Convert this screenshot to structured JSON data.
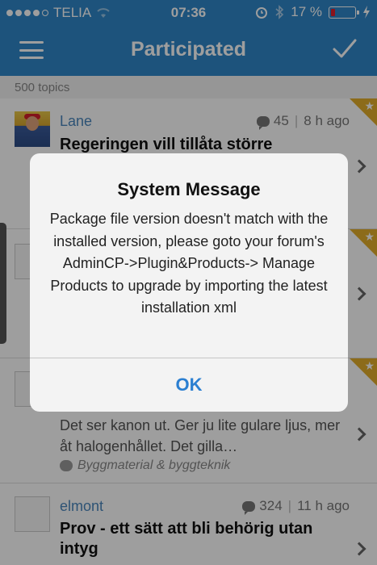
{
  "status_bar": {
    "carrier": "TELIA",
    "time": "07:36",
    "battery_percent": "17 %",
    "battery_level": 0.17
  },
  "nav": {
    "title": "Participated",
    "menu_icon": "hamburger-menu-icon",
    "confirm_icon": "checkmark-icon"
  },
  "topic_count": "500 topics",
  "topics": [
    {
      "author": "Lane",
      "replies": "45",
      "time": "8 h ago",
      "title": "Regeringen vill tillåta större",
      "avatar": "photo"
    },
    {
      "author": "",
      "replies": "",
      "time": "",
      "title": "",
      "avatar": "placeholder"
    },
    {
      "author": "",
      "replies": "",
      "time": "",
      "preview": "Det ser kanon ut. Ger ju lite gularе ljus, mer åt halogenhållet. Det gilla…",
      "category": "Byggmaterial & byggteknik",
      "avatar": "placeholder"
    },
    {
      "author": "elmont",
      "replies": "324",
      "time": "11 h ago",
      "title": "Prov - ett sätt att bli behörig utan intyg",
      "avatar": "placeholder"
    }
  ],
  "alert": {
    "title": "System Message",
    "message": "Package file version doesn't match with the installed version, please goto your forum's AdminCP->Plugin&Products-> Manage Products to upgrade by importing the latest installation xml",
    "button": "OK"
  },
  "colors": {
    "nav_bg": "#2f86c9",
    "link": "#4b87bd",
    "alert_button": "#2b7fd1",
    "badge": "#e3ad2a",
    "battery_low": "#e3202a"
  }
}
